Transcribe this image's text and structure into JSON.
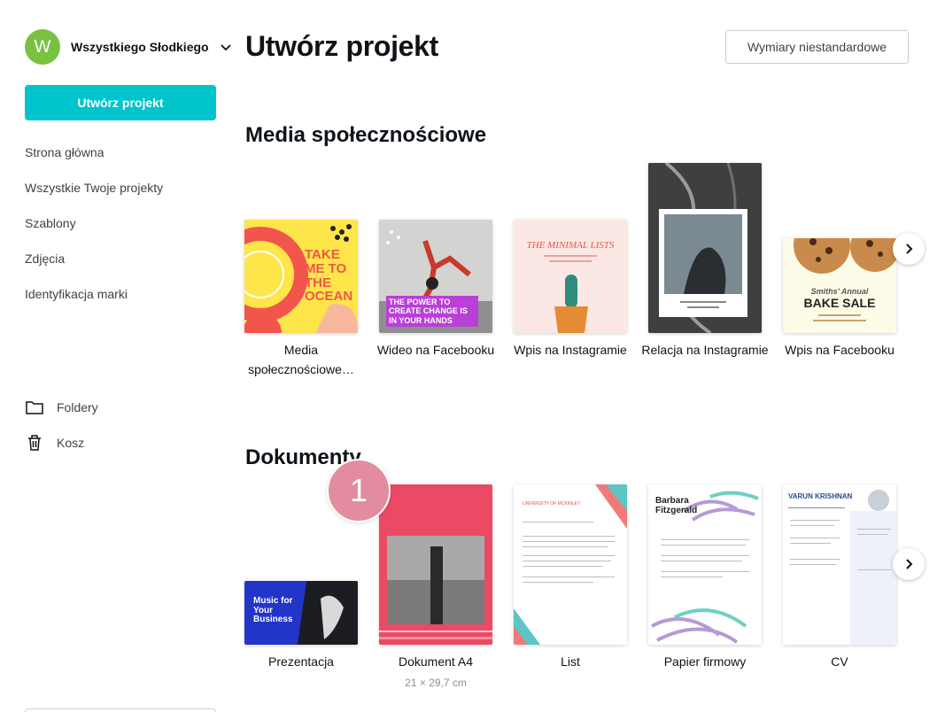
{
  "account": {
    "initial": "W",
    "name": "Wszystkiego Słodkiego"
  },
  "sidebar": {
    "create_label": "Utwórz projekt",
    "nav": [
      "Strona główna",
      "Wszystkie Twoje projekty",
      "Szablony",
      "Zdjęcia",
      "Identyfikacja marki"
    ],
    "folders_label": "Foldery",
    "trash_label": "Kosz"
  },
  "header": {
    "title": "Utwórz projekt",
    "custom_label": "Wymiary niestandardowe"
  },
  "social": {
    "title": "Media społecznościowe",
    "cards": [
      {
        "label": "Media społecznościowe…",
        "thumb_text": "TAKE ME TO THE OCEAN"
      },
      {
        "label": "Wideo na Facebooku",
        "thumb_text": "THE POWER TO CREATE CHANGE IS IN YOUR HANDS"
      },
      {
        "label": "Wpis na Instagramie",
        "thumb_text": "THE MINIMAL LISTS"
      },
      {
        "label": "Relacja na Instagramie",
        "thumb_text": ""
      },
      {
        "label": "Wpis na Facebooku",
        "thumb_text": "BAKE SALE",
        "thumb_sub": "Smiths' Annual"
      }
    ]
  },
  "documents": {
    "title": "Dokumenty",
    "badge": "1",
    "cards": [
      {
        "label": "Prezentacja",
        "thumb_text": "Music for Your Business"
      },
      {
        "label": "Dokument A4",
        "sub": "21 × 29,7 cm"
      },
      {
        "label": "List",
        "thumb_text": "UNIVERSITY OF MCKINLEY"
      },
      {
        "label": "Papier firmowy",
        "thumb_text": "Barbara Fitzgerald"
      },
      {
        "label": "CV",
        "thumb_text": "VARUN KRISHNAN"
      }
    ]
  },
  "colors": {
    "accent": "#00c4cc",
    "avatar": "#7ac142",
    "badge": "#e38ca0"
  },
  "icons": [
    "chevron-down-icon",
    "folder-icon",
    "trash-icon",
    "chevron-right-icon"
  ]
}
